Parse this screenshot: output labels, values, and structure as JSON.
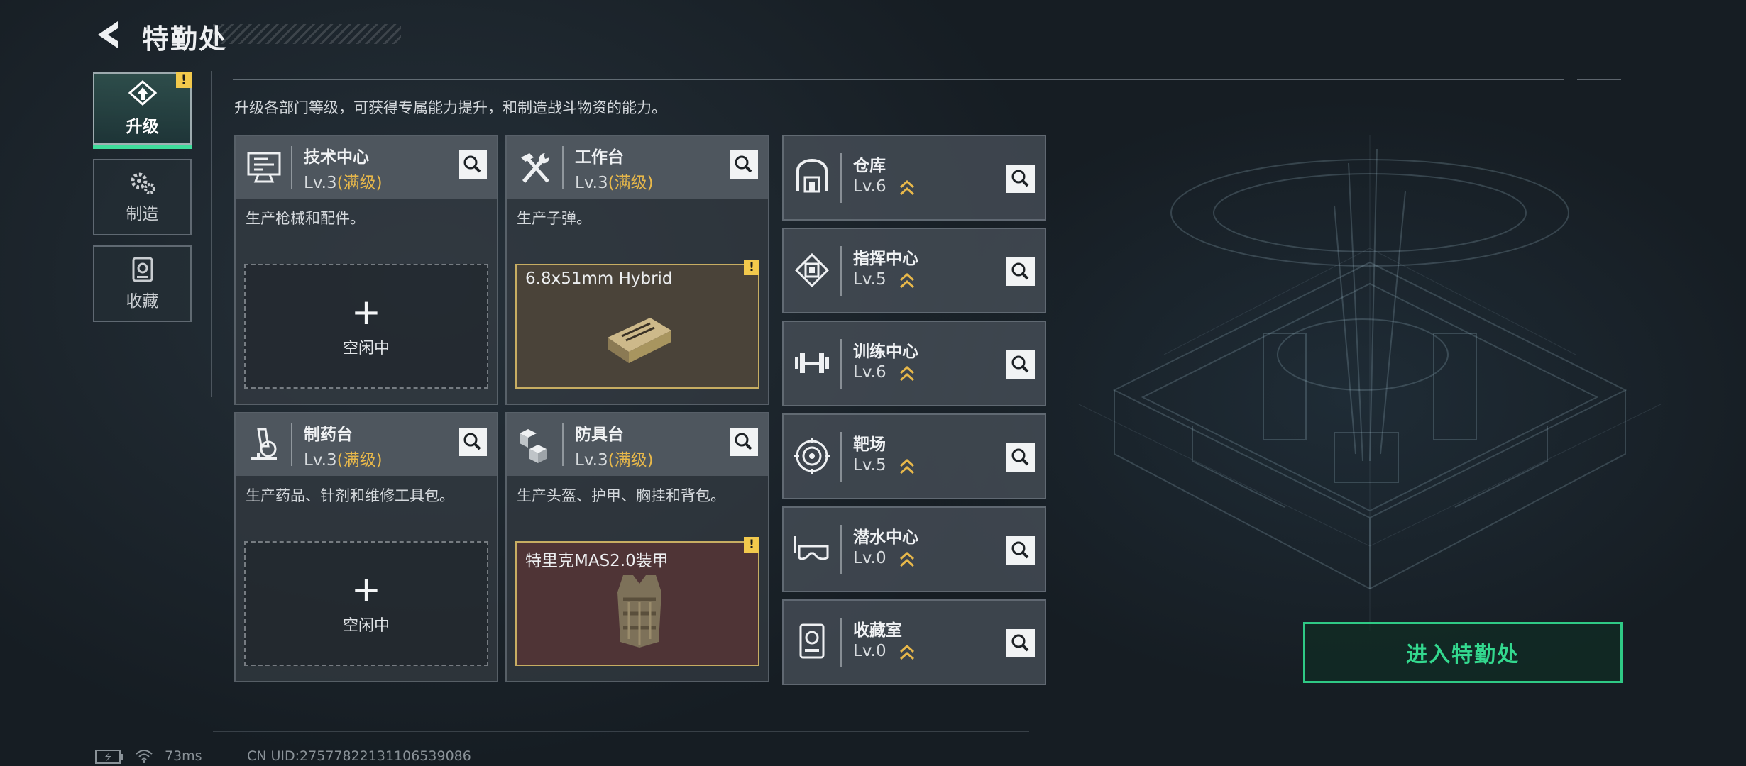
{
  "header": {
    "title": "特勤处",
    "back_icon": "back-arrow-icon"
  },
  "nav": [
    {
      "label": "升级",
      "icon": "upgrade-icon",
      "active": true,
      "badge": "!"
    },
    {
      "label": "制造",
      "icon": "gears-icon",
      "active": false
    },
    {
      "label": "收藏",
      "icon": "collection-icon",
      "active": false
    }
  ],
  "description": "升级各部门等级，可获得专属能力提升，和制造战斗物资的能力。",
  "production_cards": [
    {
      "name": "技术中心",
      "level": "Lv.3",
      "max_label": "(满级)",
      "desc": "生产枪械和配件。",
      "slot_state": "idle",
      "plus": "+",
      "slot_text": "空闲中",
      "icon": "computer-icon"
    },
    {
      "name": "工作台",
      "level": "Lv.3",
      "max_label": "(满级)",
      "desc": "生产子弹。",
      "slot_state": "producing",
      "slot_text": "6.8x51mm Hybrid",
      "badge": "!",
      "icon": "tools-icon"
    },
    {
      "name": "制药台",
      "level": "Lv.3",
      "max_label": "(满级)",
      "desc": "生产药品、针剂和维修工具包。",
      "slot_state": "idle",
      "plus": "+",
      "slot_text": "空闲中",
      "icon": "microscope-icon"
    },
    {
      "name": "防具台",
      "level": "Lv.3",
      "max_label": "(满级)",
      "desc": "生产头盔、护甲、胸挂和背包。",
      "slot_state": "producing",
      "slot_text": "特里克MAS2.0装甲",
      "badge": "!",
      "icon": "boxes-icon"
    }
  ],
  "facilities": [
    {
      "name": "仓库",
      "level": "Lv.6",
      "icon": "warehouse-icon"
    },
    {
      "name": "指挥中心",
      "level": "Lv.5",
      "icon": "command-chip-icon"
    },
    {
      "name": "训练中心",
      "level": "Lv.6",
      "icon": "dumbbell-icon"
    },
    {
      "name": "靶场",
      "level": "Lv.5",
      "icon": "target-icon"
    },
    {
      "name": "潜水中心",
      "level": "Lv.0",
      "icon": "diving-mask-icon"
    },
    {
      "name": "收藏室",
      "level": "Lv.0",
      "icon": "collection-room-icon"
    }
  ],
  "enter_button": "进入特勤处",
  "footer": {
    "ping": "73ms",
    "uid": "CN UID:27577822131106539086"
  },
  "colors": {
    "accent_green": "#33d88e",
    "max_gold": "#e8b84a",
    "badge_yellow": "#f2c94c",
    "item_border": "#c7ad62"
  }
}
